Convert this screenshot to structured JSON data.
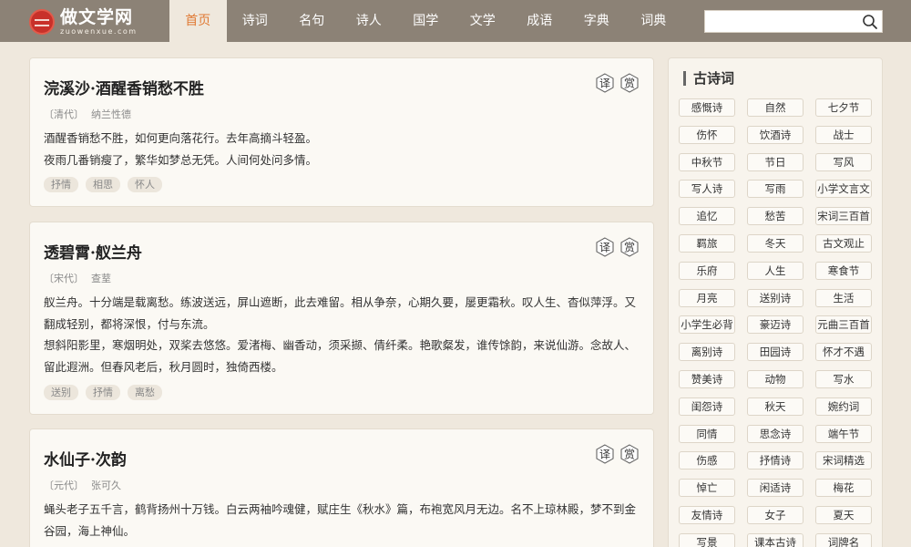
{
  "site": {
    "title": "做文学网",
    "domain": "zuowenxue.com"
  },
  "nav": {
    "items": [
      {
        "label": "首页",
        "active": true
      },
      {
        "label": "诗词"
      },
      {
        "label": "名句"
      },
      {
        "label": "诗人"
      },
      {
        "label": "国学"
      },
      {
        "label": "文学"
      },
      {
        "label": "成语"
      },
      {
        "label": "字典"
      },
      {
        "label": "词典"
      }
    ]
  },
  "search": {
    "value": "",
    "placeholder": ""
  },
  "poem_actions": {
    "translate": "译",
    "appreciate": "赏"
  },
  "poems": [
    {
      "title": "浣溪沙·酒醒香销愁不胜",
      "dynasty": "〔清代〕",
      "author": "纳兰性德",
      "lines": [
        "酒醒香销愁不胜，如何更向落花行。去年高摘斗轻盈。",
        "夜雨几番销瘦了，繁华如梦总无凭。人间何处问多情。"
      ],
      "tags": [
        "抒情",
        "相思",
        "怀人"
      ]
    },
    {
      "title": "透碧霄·舣兰舟",
      "dynasty": "〔宋代〕",
      "author": "查荎",
      "lines": [
        "舣兰舟。十分端是载离愁。练波送远，屏山遮断，此去难留。相从争奈，心期久要，屡更霜秋。叹人生、杳似萍浮。又翻成轻别，都将深恨，付与东流。",
        "想斜阳影里，寒烟明处，双桨去悠悠。爱渚梅、幽香动，须采撷、倩纤柔。艳歌粲发，谁传馀韵，来说仙游。念故人、留此遐洲。但春风老后，秋月圆时，独倚西楼。"
      ],
      "tags": [
        "送别",
        "抒情",
        "离愁"
      ]
    },
    {
      "title": "水仙子·次韵",
      "dynasty": "〔元代〕",
      "author": "张可久",
      "lines": [
        "蝇头老子五千言，鹤背扬州十万钱。白云两袖吟魂健，赋庄生《秋水》篇，布袍宽风月无边。名不上琼林殿，梦不到金谷园，海上神仙。"
      ],
      "tags": []
    }
  ],
  "sidebar": {
    "title": "古诗词",
    "categories": [
      "感慨诗",
      "自然",
      "七夕节",
      "伤怀",
      "饮酒诗",
      "战士",
      "中秋节",
      "节日",
      "写风",
      "写人诗",
      "写雨",
      "小学文言文",
      "追忆",
      "愁苦",
      "宋词三百首",
      "羁旅",
      "冬天",
      "古文观止",
      "乐府",
      "人生",
      "寒食节",
      "月亮",
      "送别诗",
      "生活",
      "小学生必背",
      "豪迈诗",
      "元曲三百首",
      "离别诗",
      "田园诗",
      "怀才不遇",
      "赞美诗",
      "动物",
      "写水",
      "闺怨诗",
      "秋天",
      "婉约词",
      "同情",
      "思念诗",
      "端午节",
      "伤感",
      "抒情诗",
      "宋词精选",
      "悼亡",
      "闲适诗",
      "梅花",
      "友情诗",
      "女子",
      "夏天",
      "写景",
      "课本古诗",
      "词牌名"
    ]
  }
}
